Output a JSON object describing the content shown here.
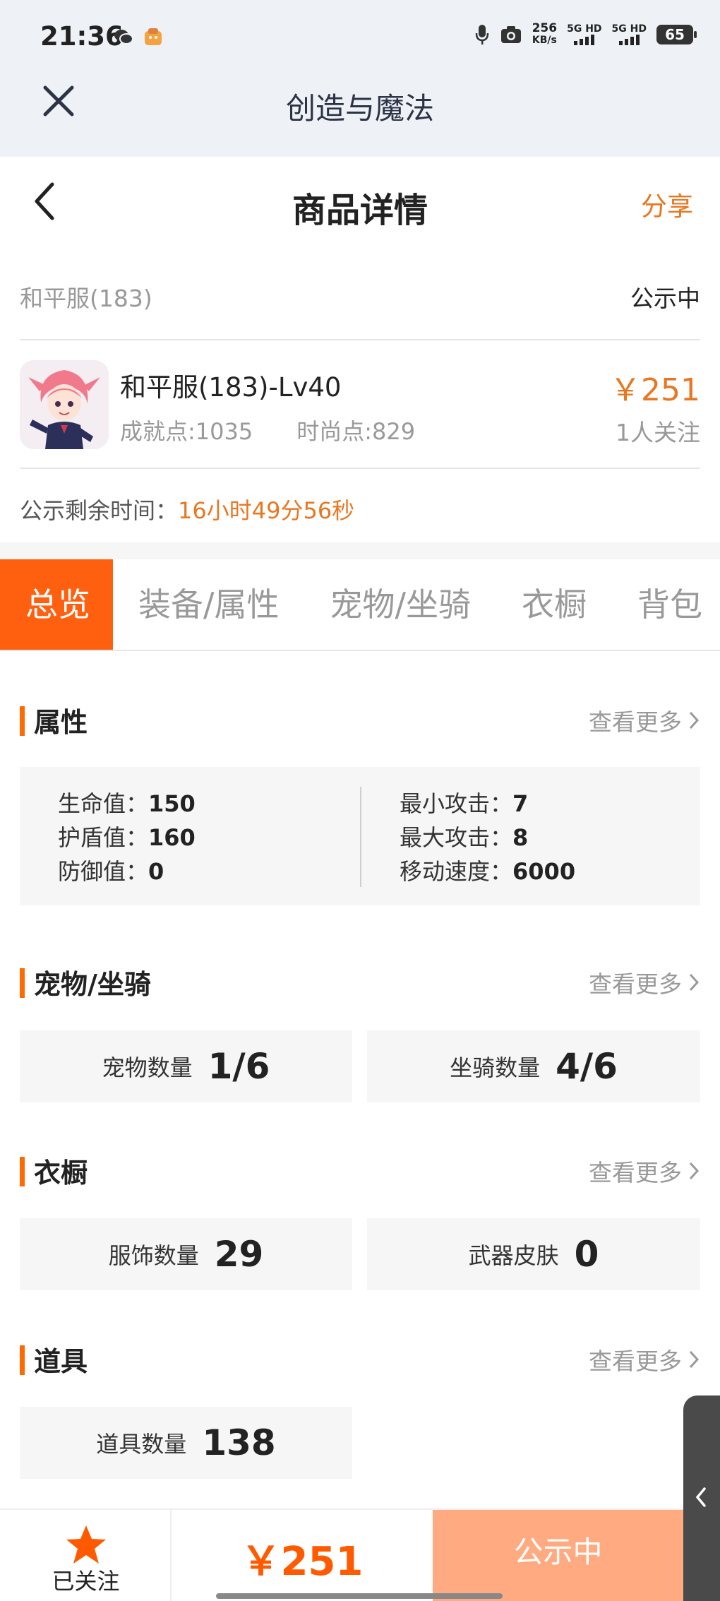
{
  "status_bar": {
    "time": "21:36",
    "net_speed_value": "256",
    "net_speed_unit": "KB/s",
    "sim1": "5G HD",
    "sim2": "5G HD",
    "battery": "65"
  },
  "mini_program": {
    "title": "创造与魔法"
  },
  "header": {
    "title": "商品详情",
    "share_label": "分享"
  },
  "server": {
    "name": "和平服(183)",
    "status": "公示中"
  },
  "item": {
    "name": "和平服(183)-Lv40",
    "achievement": "成就点:1035",
    "fashion": "时尚点:829",
    "price": "￥251",
    "followers": "1人关注"
  },
  "remaining": {
    "label": "公示剩余时间：",
    "value": "16小时49分56秒"
  },
  "tabs": [
    {
      "label": "总览",
      "active": true
    },
    {
      "label": "装备/属性",
      "active": false
    },
    {
      "label": "宠物/坐骑",
      "active": false
    },
    {
      "label": "衣橱",
      "active": false
    },
    {
      "label": "背包",
      "active": false
    }
  ],
  "sections": {
    "attributes": {
      "title": "属性",
      "more": "查看更多",
      "left": [
        {
          "label": "生命值：",
          "value": "150"
        },
        {
          "label": "护盾值：",
          "value": "160"
        },
        {
          "label": "防御值：",
          "value": "0"
        }
      ],
      "right": [
        {
          "label": "最小攻击：",
          "value": "7"
        },
        {
          "label": "最大攻击：",
          "value": "8"
        },
        {
          "label": "移动速度：",
          "value": "6000"
        }
      ]
    },
    "pets": {
      "title": "宠物/坐骑",
      "more": "查看更多",
      "cards": [
        {
          "label": "宠物数量",
          "value": "1/6"
        },
        {
          "label": "坐骑数量",
          "value": "4/6"
        }
      ]
    },
    "wardrobe": {
      "title": "衣橱",
      "more": "查看更多",
      "cards": [
        {
          "label": "服饰数量",
          "value": "29"
        },
        {
          "label": "武器皮肤",
          "value": "0"
        }
      ]
    },
    "items": {
      "title": "道具",
      "more": "查看更多",
      "cards": [
        {
          "label": "道具数量",
          "value": "138"
        }
      ]
    }
  },
  "bottom_bar": {
    "follow_label": "已关注",
    "price": "￥251",
    "status_label": "公示中"
  },
  "colors": {
    "accent": "#ff6010",
    "price": "#e87722",
    "status_button": "#ffaa80"
  }
}
